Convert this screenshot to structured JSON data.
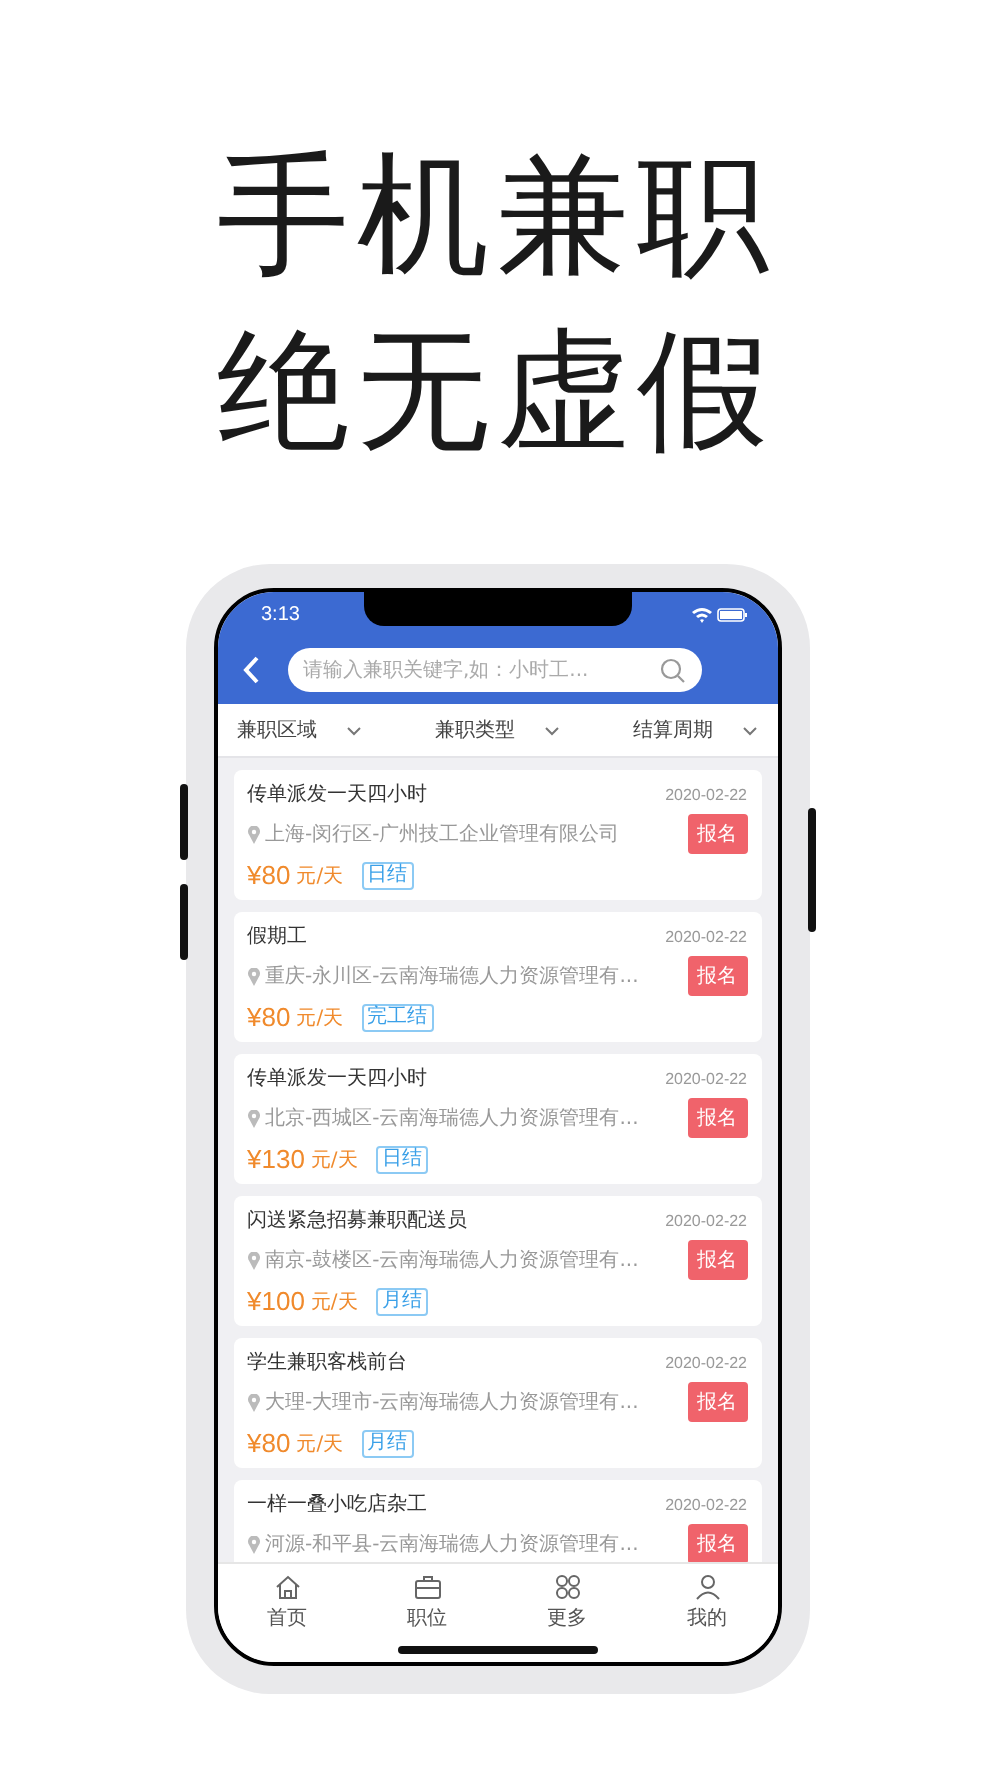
{
  "headline": [
    "手机兼职",
    "绝无虚假"
  ],
  "status_bar": {
    "time": "3:13"
  },
  "search": {
    "placeholder": "请输入兼职关键字,如：小时工..."
  },
  "filters": [
    {
      "label": "兼职区域"
    },
    {
      "label": "兼职类型"
    },
    {
      "label": "结算周期"
    }
  ],
  "jobs": [
    {
      "title": "传单派发一天四小时",
      "date": "2020-02-22",
      "address": "上海-闵行区-广州技工企业管理有限公司",
      "price": "¥80",
      "unit": "元/天",
      "settlement": "日结",
      "button": "报名"
    },
    {
      "title": "假期工",
      "date": "2020-02-22",
      "address": "重庆-永川区-云南海瑞德人力资源管理有...",
      "price": "¥80",
      "unit": "元/天",
      "settlement": "完工结",
      "button": "报名"
    },
    {
      "title": "传单派发一天四小时",
      "date": "2020-02-22",
      "address": "北京-西城区-云南海瑞德人力资源管理有...",
      "price": "¥130",
      "unit": "元/天",
      "settlement": "日结",
      "button": "报名"
    },
    {
      "title": "闪送紧急招募兼职配送员",
      "date": "2020-02-22",
      "address": "南京-鼓楼区-云南海瑞德人力资源管理有...",
      "price": "¥100",
      "unit": "元/天",
      "settlement": "月结",
      "button": "报名"
    },
    {
      "title": "学生兼职客栈前台",
      "date": "2020-02-22",
      "address": "大理-大理市-云南海瑞德人力资源管理有...",
      "price": "¥80",
      "unit": "元/天",
      "settlement": "月结",
      "button": "报名"
    },
    {
      "title": "一样一叠小吃店杂工",
      "date": "2020-02-22",
      "address": "河源-和平县-云南海瑞德人力资源管理有...",
      "button": "报名"
    }
  ],
  "tab_bar": [
    {
      "label": "首页"
    },
    {
      "label": "职位"
    },
    {
      "label": "更多"
    },
    {
      "label": "我的"
    }
  ]
}
